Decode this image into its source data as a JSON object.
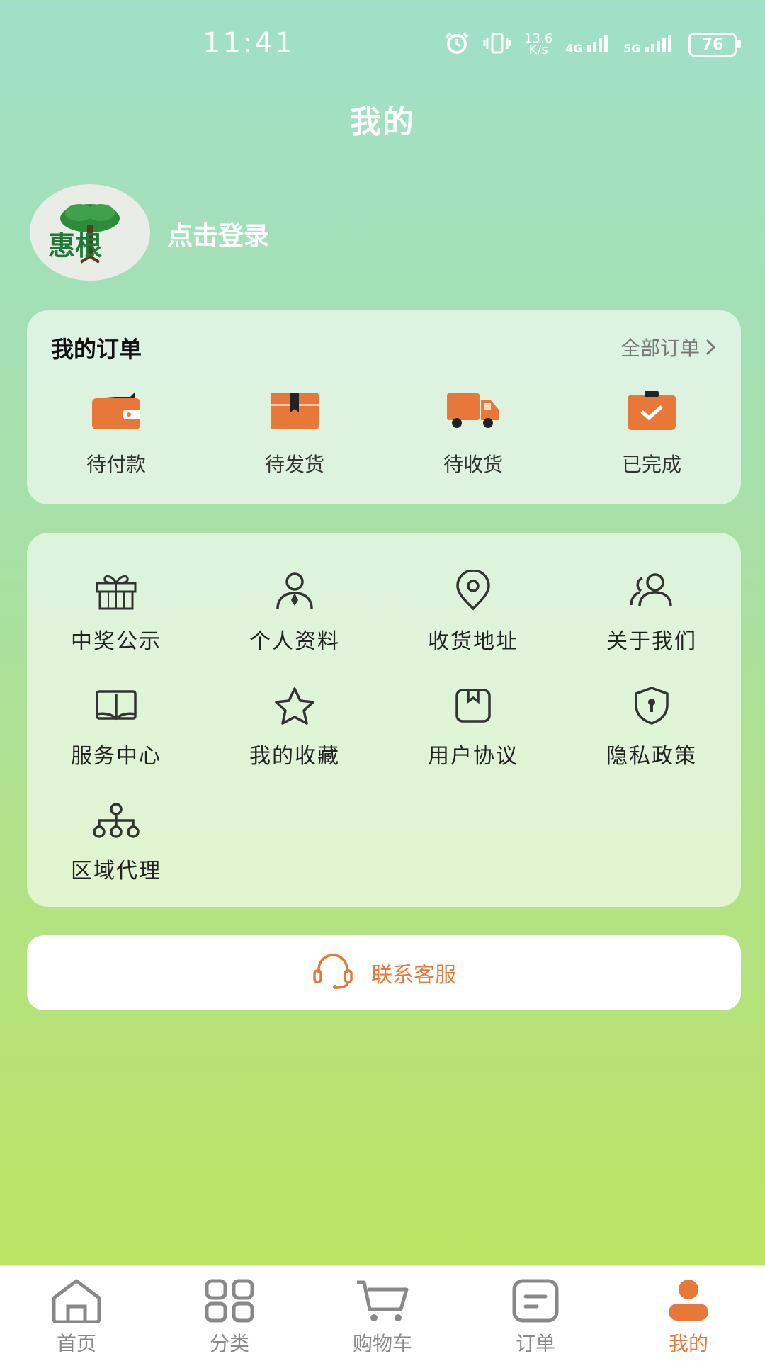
{
  "status_bar": {
    "time": "11:41",
    "speed_top": "13.6",
    "speed_bottom": "K/s",
    "net1": "4G",
    "net2": "5G",
    "battery": "76",
    "icons": [
      "alarm-icon",
      "vibrate-icon",
      "signal-icon",
      "battery-icon"
    ]
  },
  "header": {
    "title": "我的"
  },
  "profile": {
    "login_text": "点击登录",
    "logo_text": "惠根"
  },
  "orders": {
    "title": "我的订单",
    "all_label": "全部订单",
    "items": [
      {
        "label": "待付款",
        "icon": "wallet-icon"
      },
      {
        "label": "待发货",
        "icon": "package-icon"
      },
      {
        "label": "待收货",
        "icon": "truck-icon"
      },
      {
        "label": "已完成",
        "icon": "clipboard-check-icon"
      }
    ]
  },
  "services": {
    "items": [
      {
        "label": "中奖公示",
        "icon": "gift-icon"
      },
      {
        "label": "个人资料",
        "icon": "user-profile-icon"
      },
      {
        "label": "收货地址",
        "icon": "location-pin-icon"
      },
      {
        "label": "关于我们",
        "icon": "group-icon"
      },
      {
        "label": "服务中心",
        "icon": "book-icon"
      },
      {
        "label": "我的收藏",
        "icon": "star-icon"
      },
      {
        "label": "用户协议",
        "icon": "agreement-icon"
      },
      {
        "label": "隐私政策",
        "icon": "shield-lock-icon"
      },
      {
        "label": "区域代理",
        "icon": "network-icon"
      }
    ]
  },
  "contact": {
    "label": "联系客服",
    "icon": "headset-icon"
  },
  "tabs": [
    {
      "label": "首页",
      "icon": "home-icon"
    },
    {
      "label": "分类",
      "icon": "grid-icon"
    },
    {
      "label": "购物车",
      "icon": "cart-icon"
    },
    {
      "label": "订单",
      "icon": "order-icon"
    },
    {
      "label": "我的",
      "icon": "user-icon"
    }
  ],
  "colors": {
    "accent": "#e8783a",
    "text_dark": "#222222",
    "text_muted": "#888888"
  }
}
